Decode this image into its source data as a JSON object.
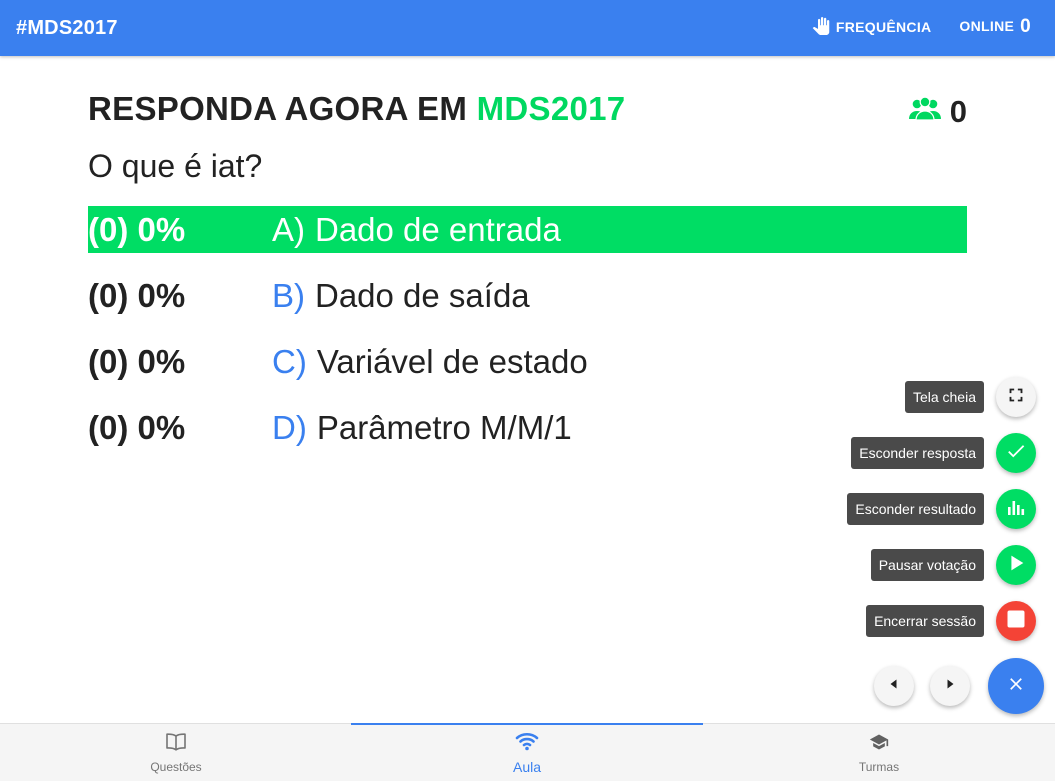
{
  "header": {
    "brand": "#MDS2017",
    "frequency_label": "FREQUÊNCIA",
    "online_label": "ONLINE",
    "online_count": "0"
  },
  "main": {
    "title_prefix": "RESPONDA AGORA EM ",
    "class_code": "MDS2017",
    "participants_count": "0",
    "question": "O que é iat?",
    "options": [
      {
        "stat": "(0) 0%",
        "letter": "A)",
        "text": "Dado de entrada",
        "selected": true
      },
      {
        "stat": "(0) 0%",
        "letter": "B)",
        "text": "Dado de saída",
        "selected": false
      },
      {
        "stat": "(0) 0%",
        "letter": "C)",
        "text": "Variável de estado",
        "selected": false
      },
      {
        "stat": "(0) 0%",
        "letter": "D)",
        "text": "Parâmetro M/M/1",
        "selected": false
      }
    ]
  },
  "speed_dial": {
    "fullscreen": "Tela cheia",
    "hide_answer": "Esconder resposta",
    "hide_result": "Esconder resultado",
    "pause_voting": "Pausar votação",
    "end_session": "Encerrar sessão"
  },
  "bottom_nav": {
    "tabs": [
      {
        "label": "Questões",
        "icon": "book-icon"
      },
      {
        "label": "Aula",
        "icon": "wifi-icon"
      },
      {
        "label": "Turmas",
        "icon": "school-icon"
      }
    ]
  },
  "colors": {
    "primary": "#3a80ef",
    "green": "#00dd64",
    "red": "#f44336"
  }
}
